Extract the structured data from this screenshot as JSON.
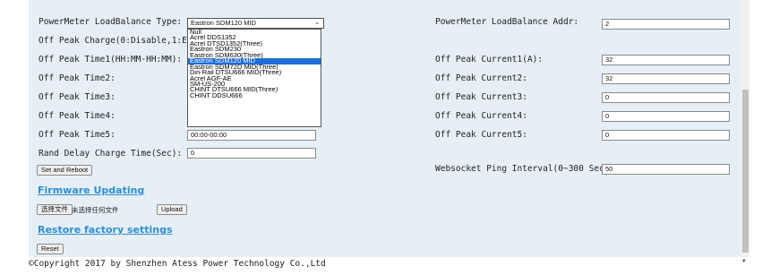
{
  "form": {
    "loadbalance_type_label": "PowerMeter LoadBalance Type:",
    "loadbalance_type_value": "Eastron SDM120 MID",
    "offpeak_charge_label": "Off Peak Charge(0:Disable,1:Enable):",
    "offpeak_time1_label": "Off Peak Time1(HH:MM-HH:MM):",
    "offpeak_time2_label": "Off Peak Time2:",
    "offpeak_time3_label": "Off Peak Time3:",
    "offpeak_time4_label": "Off Peak Time4:",
    "offpeak_time5_label": "Off Peak Time5:",
    "offpeak_time5_value": "00:00-00:00",
    "rand_delay_label": "Rand Delay Charge Time(Sec):",
    "rand_delay_value": "0",
    "set_reboot_label": "Set and Reboot",
    "loadbalance_addr_label": "PowerMeter LoadBalance Addr:",
    "loadbalance_addr_value": "2",
    "offpeak_current1_label": "Off Peak Current1(A):",
    "offpeak_current1_value": "32",
    "offpeak_current2_label": "Off Peak Current2:",
    "offpeak_current2_value": "32",
    "offpeak_current3_label": "Off Peak Current3:",
    "offpeak_current3_value": "0",
    "offpeak_current4_label": "Off Peak Current4:",
    "offpeak_current4_value": "0",
    "offpeak_current5_label": "Off Peak Current5:",
    "offpeak_current5_value": "0",
    "websocket_label": "Websocket Ping Interval(0~300 Sec):",
    "websocket_value": "50"
  },
  "dropdown": {
    "options": [
      "Null",
      "Acrel DDS1352",
      "Acrel DTSD1352(Three)",
      "Eastron SDM230",
      "Eastron SDM630(Three)",
      "Eastron SDM120 MID",
      "Eastron SDM72D MID(Three)",
      "Din-Rail DTSU666 MID(Three)",
      "Acrel AGF-AE",
      "SM-US-200",
      "CHINT DTSU666 MID(Three)",
      "CHINT DDSU666"
    ],
    "selected_index": 5
  },
  "firmware": {
    "title": "Firmware Updating",
    "choose_file_label": "选择文件",
    "no_file_text": "未选择任何文件",
    "upload_label": "Upload"
  },
  "restore": {
    "title": "Restore factory settings",
    "reset_label": "Reset"
  },
  "footer": {
    "copyright": "©Copyright 2017 by Shenzhen Atess Power Technology Co.,Ltd"
  },
  "colors": {
    "panel_bg": "#e6eff6",
    "link": "#2e8fd6",
    "selected_option": "#1e6cd6"
  }
}
